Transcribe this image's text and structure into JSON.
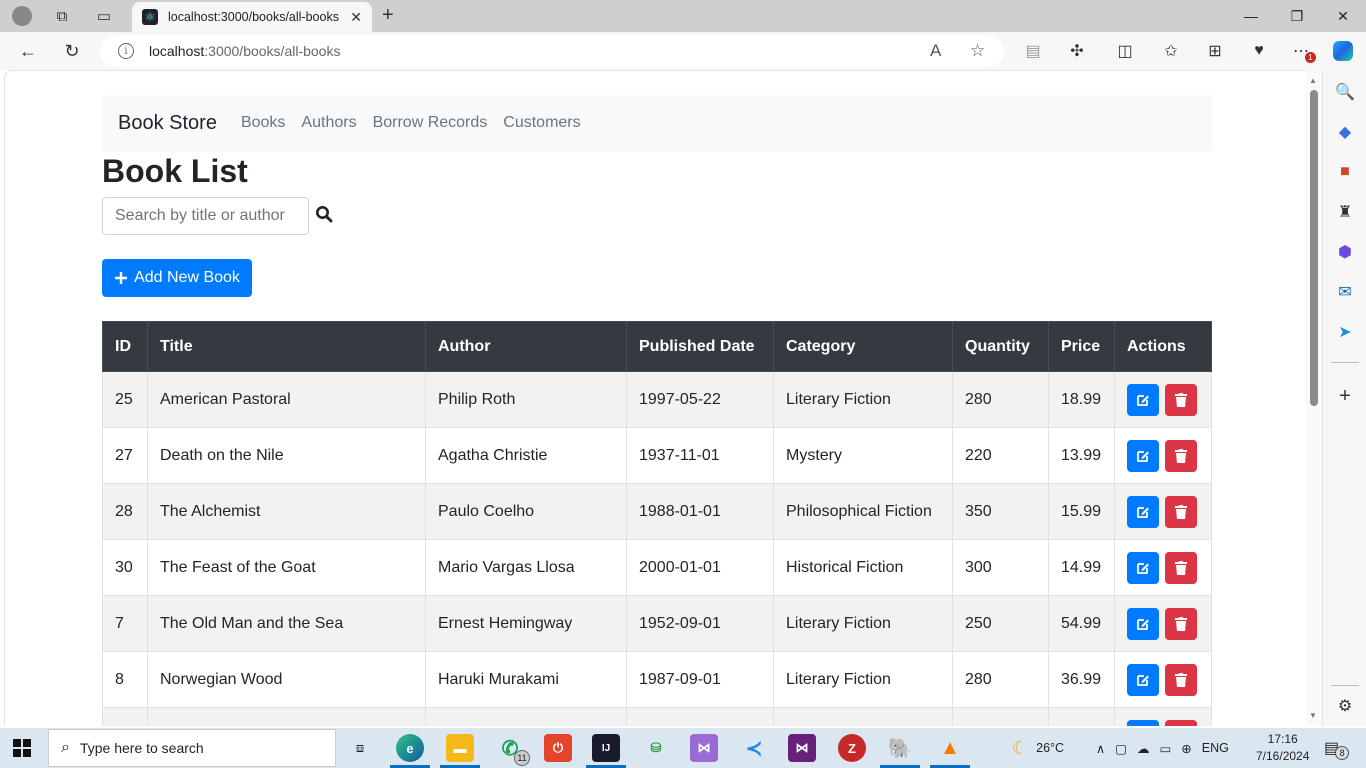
{
  "browser": {
    "tab_title": "localhost:3000/books/all-books",
    "url_host": "localhost",
    "url_path": ":3000/books/all-books",
    "notification_badge": "1"
  },
  "navbar": {
    "brand": "Book Store",
    "links": [
      "Books",
      "Authors",
      "Borrow Records",
      "Customers"
    ]
  },
  "page": {
    "title": "Book List",
    "search_placeholder": "Search by title or author",
    "add_button": "Add New Book"
  },
  "table": {
    "headers": [
      "ID",
      "Title",
      "Author",
      "Published Date",
      "Category",
      "Quantity",
      "Price",
      "Actions"
    ],
    "rows": [
      {
        "id": "25",
        "title": "American Pastoral",
        "author": "Philip Roth",
        "date": "1997-05-22",
        "category": "Literary Fiction",
        "quantity": "280",
        "price": "18.99"
      },
      {
        "id": "27",
        "title": "Death on the Nile",
        "author": "Agatha Christie",
        "date": "1937-11-01",
        "category": "Mystery",
        "quantity": "220",
        "price": "13.99"
      },
      {
        "id": "28",
        "title": "The Alchemist",
        "author": "Paulo Coelho",
        "date": "1988-01-01",
        "category": "Philosophical Fiction",
        "quantity": "350",
        "price": "15.99"
      },
      {
        "id": "30",
        "title": "The Feast of the Goat",
        "author": "Mario Vargas Llosa",
        "date": "2000-01-01",
        "category": "Historical Fiction",
        "quantity": "300",
        "price": "14.99"
      },
      {
        "id": "7",
        "title": "The Old Man and the Sea",
        "author": "Ernest Hemingway",
        "date": "1952-09-01",
        "category": "Literary Fiction",
        "quantity": "250",
        "price": "54.99"
      },
      {
        "id": "8",
        "title": "Norwegian Wood",
        "author": "Haruki Murakami",
        "date": "1987-09-01",
        "category": "Literary Fiction",
        "quantity": "280",
        "price": "36.99"
      },
      {
        "id": "",
        "title": "",
        "author": "",
        "date": "",
        "category": "",
        "quantity": "",
        "price": ""
      }
    ]
  },
  "taskbar": {
    "search_placeholder": "Type here to search",
    "whatsapp_badge": "11",
    "weather": "26°C",
    "language": "ENG",
    "time": "17:16",
    "date": "7/16/2024",
    "notifications": "8"
  }
}
